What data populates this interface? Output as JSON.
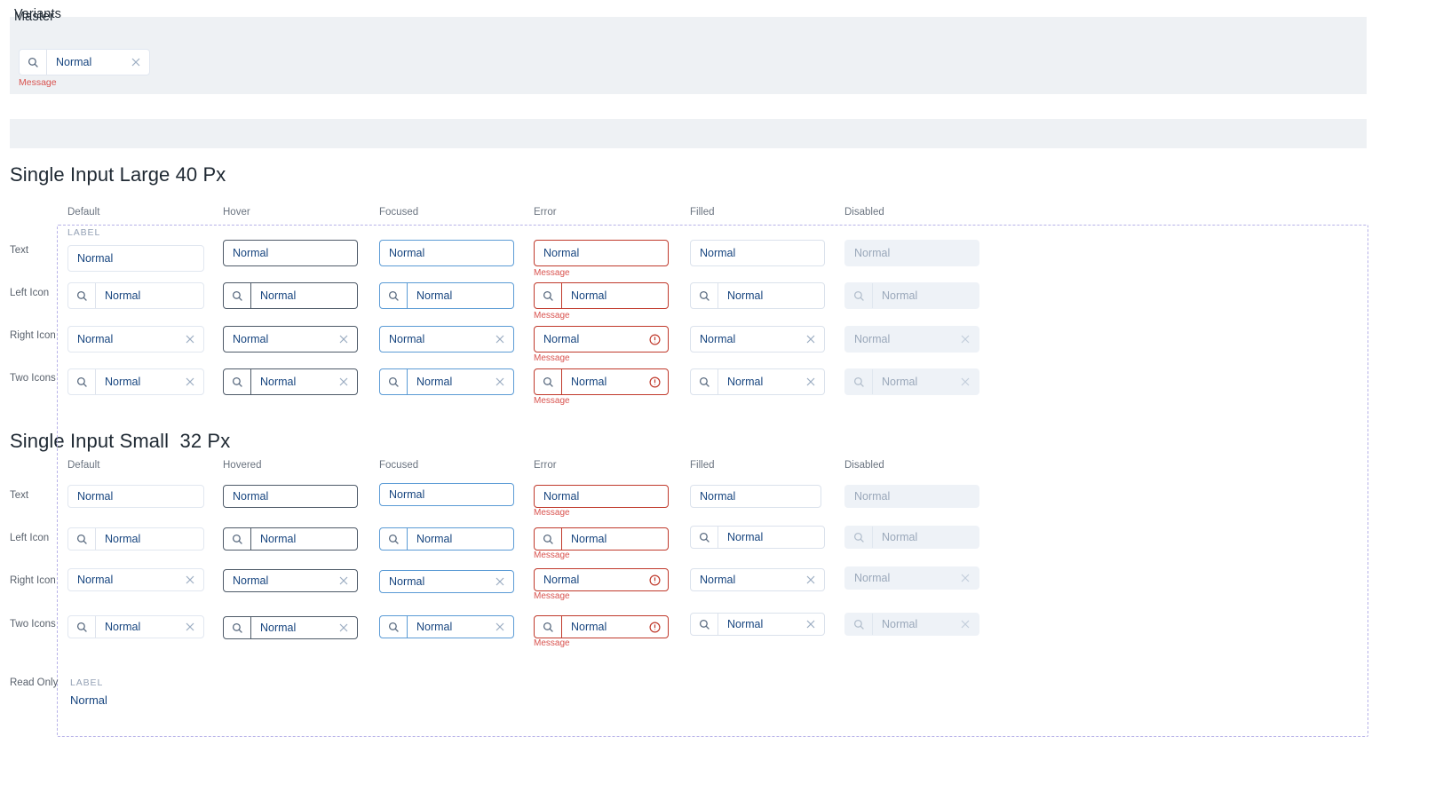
{
  "bands": {
    "master": "Master",
    "variants": "Variants"
  },
  "master": {
    "value": "Normal",
    "message": "Message",
    "search_icon": "search-icon",
    "clear_icon": "close-icon"
  },
  "sections": [
    {
      "title": "Single Input Large 40 Px",
      "size": "lg",
      "columns": [
        "Default",
        "Hover",
        "Focused",
        "Error",
        "Filled",
        "Disabled"
      ],
      "rows": [
        "Text",
        "Left Icon",
        "Right Icon",
        "Two Icons"
      ],
      "label_caption": "LABEL",
      "field_value": "Normal",
      "error_message": "Message"
    },
    {
      "title": "Single Input Small  32 Px",
      "size": "sm",
      "columns": [
        "Default",
        "Hovered",
        "Focused",
        "Error",
        "Filled",
        "Disabled"
      ],
      "rows": [
        "Text",
        "Left Icon",
        "Right Icon",
        "Two Icons"
      ],
      "field_value": "Normal",
      "error_message": "Message"
    }
  ],
  "readonly": {
    "row_label": "Read Only",
    "label_caption": "LABEL",
    "value": "Normal"
  },
  "colors": {
    "accent_text": "#17457f",
    "error": "#c0392b",
    "error_message": "#d9534f",
    "focus_border": "#5b9bd5",
    "hover_border": "#4e5a68",
    "default_border": "#e1e7f0",
    "disabled_bg": "#eef2f7",
    "dashed_outline": "#b7b2e8",
    "band_bg": "#eef1f4"
  }
}
